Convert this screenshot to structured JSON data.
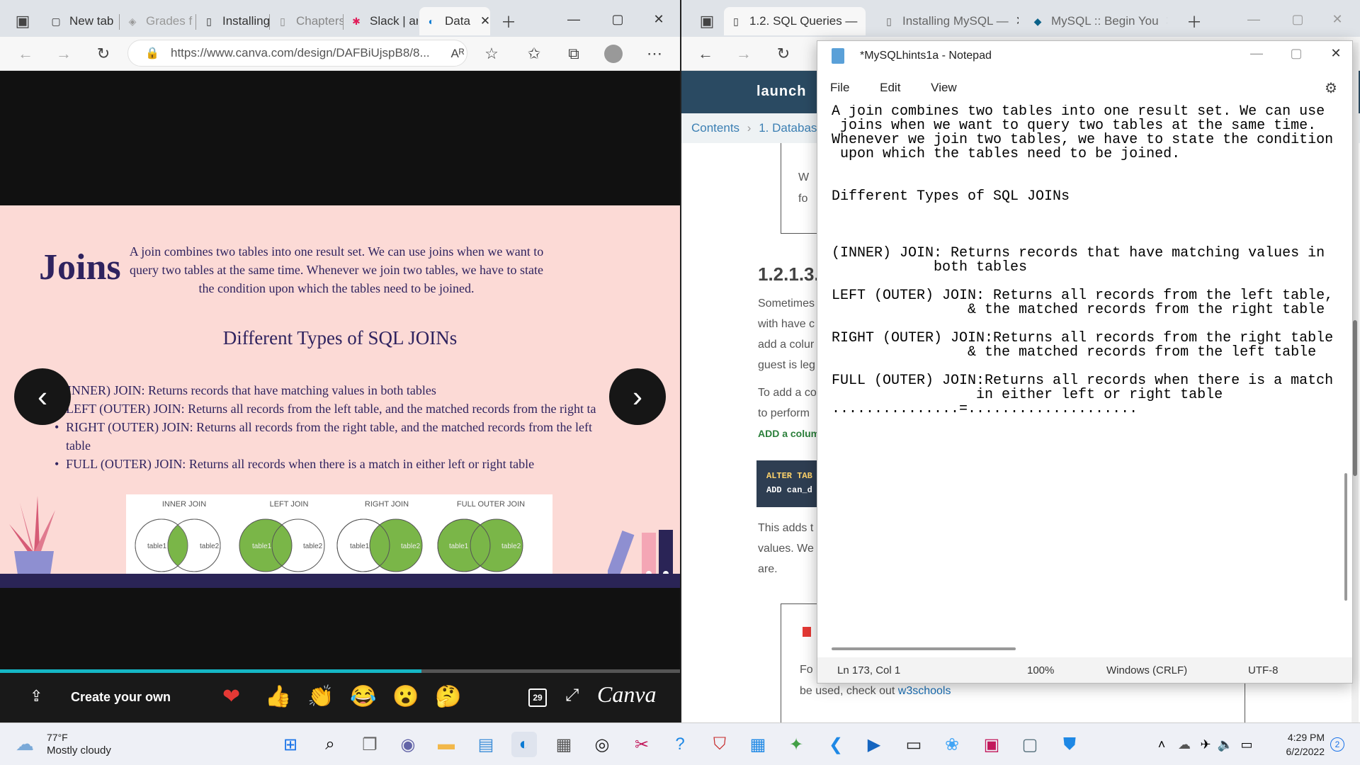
{
  "left_browser": {
    "tabs": [
      "New tab",
      "Grades f",
      "Installing",
      "Chapters",
      "Slack | ar",
      "Data"
    ],
    "url": "https://www.canva.com/design/DAFBiUjspB8/8...",
    "slide": {
      "title": "Joins",
      "intro": "A join combines two tables into one result set. We can use joins when we want to query two tables at the same time. Whenever we join two tables, we have to state the condition upon which the tables need to be joined.",
      "types_title": "Different Types of SQL JOINs",
      "bullets": [
        "INNER) JOIN: Returns records that have matching values in both tables",
        "LEFT (OUTER) JOIN: Returns all records from the left table, and the matched records from the right ta",
        "RIGHT (OUTER) JOIN: Returns all records from the right table, and the matched records from the left table",
        "FULL (OUTER) JOIN: Returns all records when there is a match in either left or right table"
      ],
      "diagram_labels": [
        "INNER JOIN",
        "LEFT JOIN",
        "RIGHT JOIN",
        "FULL OUTER JOIN"
      ],
      "table1": "table1",
      "table2": "table2"
    },
    "bottom": {
      "create_label": "Create your own",
      "page_num": "29",
      "logo": "Canva"
    },
    "progress_percent": 62,
    "colors": {
      "slide_bg": "#fcdad6",
      "navy": "#2f235f",
      "green": "#7ab648",
      "progress": "#15b7c6"
    }
  },
  "right_browser": {
    "tabs": [
      "1.2. SQL Queries —",
      "Installing MySQL —",
      "MySQL :: Begin You"
    ],
    "brand": "launch",
    "breadcrumb": [
      "Contents",
      "1. Databas"
    ],
    "heading": "1.2.1.3.",
    "lines": [
      "Sometimes",
      "with have c",
      "add a colur",
      "guest is leg",
      "To add a co",
      "to perform",
      "ADD a colum",
      "This adds t",
      "values. We",
      "are."
    ],
    "code": [
      "ALTER TAB",
      "ADD can_d"
    ],
    "footer_prefix": "Fo",
    "footer": "be used, check out",
    "footer_link": "w3schools",
    "box_text": [
      "W",
      "fo"
    ]
  },
  "notepad": {
    "title": "*MySQLhints1a - Notepad",
    "menu": [
      "File",
      "Edit",
      "View"
    ],
    "content": "A join combines two tables into one result set. We can use\n joins when we want to query two tables at the same time.\nWhenever we join two tables, we have to state the condition\n upon which the tables need to be joined.\n\n\nDifferent Types of SQL JOINs\n\n\n\n(INNER) JOIN: Returns records that have matching values in\n            both tables\n\nLEFT (OUTER) JOIN: Returns all records from the left table,\n                & the matched records from the right table\n\nRIGHT (OUTER) JOIN:Returns all records from the right table\n                & the matched records from the left table\n\nFULL (OUTER) JOIN:Returns all records when there is a match\n                 in either left or right table\n...............=....................",
    "status": {
      "position": "Ln 173, Col 1",
      "zoom": "100%",
      "line_ending": "Windows (CRLF)",
      "encoding": "UTF-8"
    }
  },
  "taskbar": {
    "weather_temp": "77°F",
    "weather_desc": "Mostly cloudy",
    "time": "4:29 PM",
    "date": "6/2/2022",
    "notifications": "2"
  }
}
